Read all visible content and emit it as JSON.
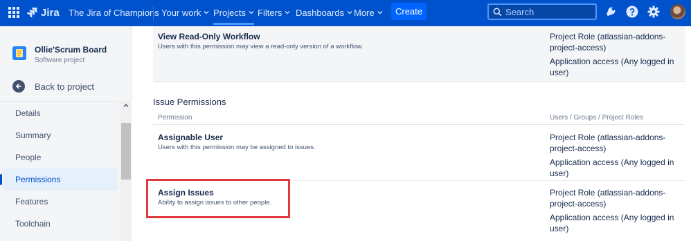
{
  "colors": {
    "topbar": "#0052CC",
    "accent": "#0065FF",
    "highlight": "#E0393E"
  },
  "topbar": {
    "app_switcher_icon": "grid-icon",
    "logo_text": "Jira",
    "site_name": "The Jira of Champions",
    "nav": [
      {
        "label": "Your work"
      },
      {
        "label": "Projects"
      },
      {
        "label": "Filters"
      },
      {
        "label": "Dashboards"
      },
      {
        "label": "More"
      }
    ],
    "create_label": "Create",
    "search_placeholder": "Search",
    "icons": [
      "notification-icon",
      "help-icon",
      "settings-icon"
    ]
  },
  "sidebar": {
    "project_name": "Ollie'Scrum Board",
    "project_type": "Software project",
    "back_label": "Back to project",
    "items": [
      {
        "label": "Details"
      },
      {
        "label": "Summary"
      },
      {
        "label": "People"
      },
      {
        "label": "Permissions",
        "selected": true
      },
      {
        "label": "Features"
      },
      {
        "label": "Toolchain"
      }
    ]
  },
  "main": {
    "top_row": {
      "title": "View Read-Only Workflow",
      "desc": "Users with this permission may view a read-only version of a workflow.",
      "grants": [
        "Project Role (atlassian-addons-project-access)",
        "Application access (Any logged in user)"
      ]
    },
    "section_title": "Issue Permissions",
    "columns": {
      "permission": "Permission",
      "grantees": "Users / Groups / Project Roles"
    },
    "rows": [
      {
        "title": "Assignable User",
        "desc": "Users with this permission may be assigned to issues.",
        "grants": [
          "Project Role (atlassian-addons-project-access)",
          "Application access (Any logged in user)"
        ]
      },
      {
        "title": "Assign Issues",
        "desc": "Ability to assign issues to other people.",
        "grants": [
          "Project Role (atlassian-addons-project-access)",
          "Application access (Any logged in user)"
        ]
      }
    ]
  }
}
